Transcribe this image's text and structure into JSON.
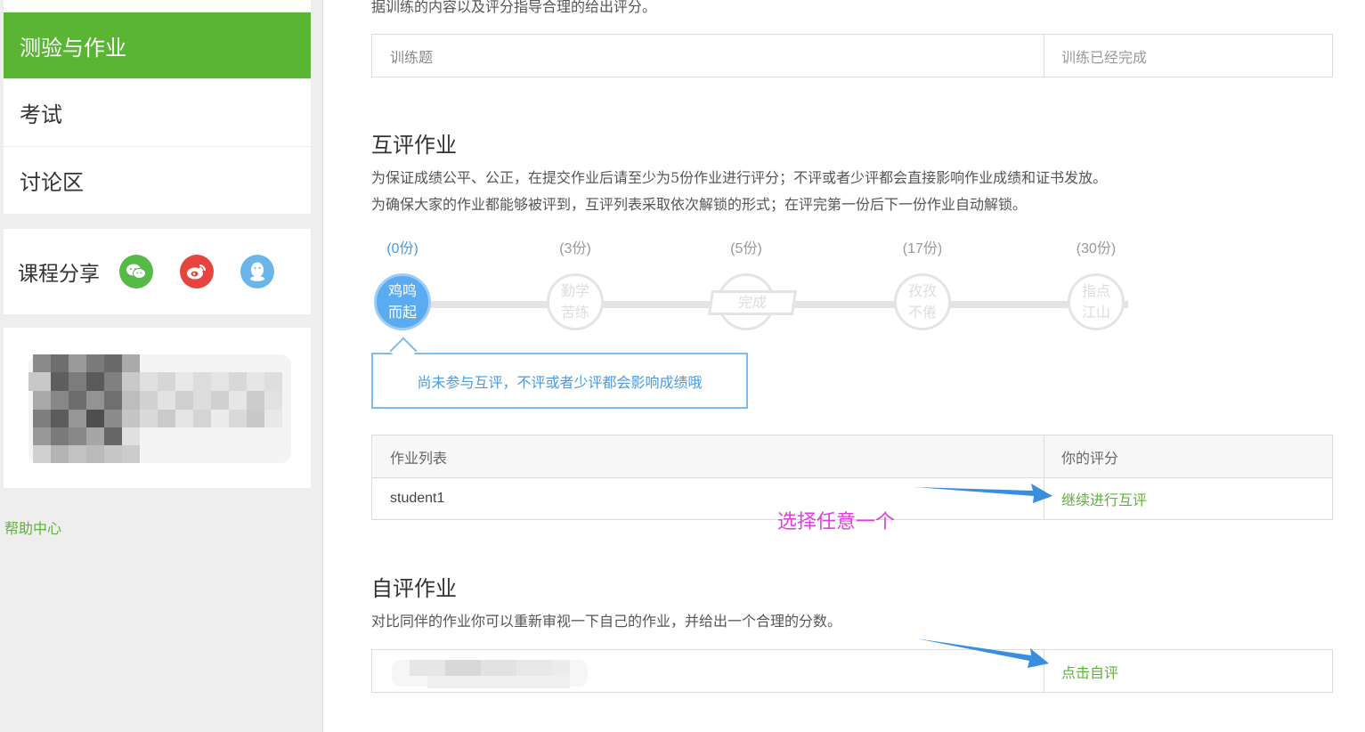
{
  "sidebar": {
    "nav": [
      {
        "label": "测验与作业",
        "active": true
      },
      {
        "label": "考试",
        "active": false
      },
      {
        "label": "讨论区",
        "active": false
      }
    ],
    "share": {
      "label": "课程分享",
      "icons": [
        "wechat-icon",
        "weibo-icon",
        "qq-icon"
      ]
    },
    "help_link": "帮助中心"
  },
  "training": {
    "description": "据训练的内容以及评分指导合理的给出评分。",
    "row": {
      "title": "训练题",
      "status": "训练已经完成"
    }
  },
  "peer_review": {
    "title": "互评作业",
    "desc_line1": "为保证成绩公平、公正，在提交作业后请至少为5份作业进行评分；不评或者少评都会直接影响作业成绩和证书发放。",
    "desc_line2": "为确保大家的作业都能够被评到，互评列表采取依次解锁的形式；在评完第一份后下一份作业自动解锁。",
    "steps": [
      {
        "count": "(0份)",
        "line1": "鸡鸣",
        "line2": "而起",
        "active": true
      },
      {
        "count": "(3份)",
        "line1": "勤学",
        "line2": "苦练",
        "active": false
      },
      {
        "count": "(5份)",
        "line1": "完成",
        "line2": "",
        "active": false
      },
      {
        "count": "(17份)",
        "line1": "孜孜",
        "line2": "不倦",
        "active": false
      },
      {
        "count": "(30份)",
        "line1": "指点",
        "line2": "江山",
        "active": false
      }
    ],
    "tip": "尚未参与互评，不评或者少评都会影响成绩哦",
    "table": {
      "header_list": "作业列表",
      "header_score": "你的评分",
      "rows": [
        {
          "name": "student1",
          "action": "继续进行互评"
        }
      ]
    },
    "annotation": "选择任意一个"
  },
  "self_review": {
    "title": "自评作业",
    "description": "对比同伴的作业你可以重新审视一下自己的作业，并给出一个合理的分数。",
    "action": "点击自评"
  },
  "colors": {
    "accent_green": "#5ab534",
    "accent_blue": "#4a9be0",
    "annotation_magenta": "#e040e0",
    "arrow_blue": "#3a8ee0"
  }
}
